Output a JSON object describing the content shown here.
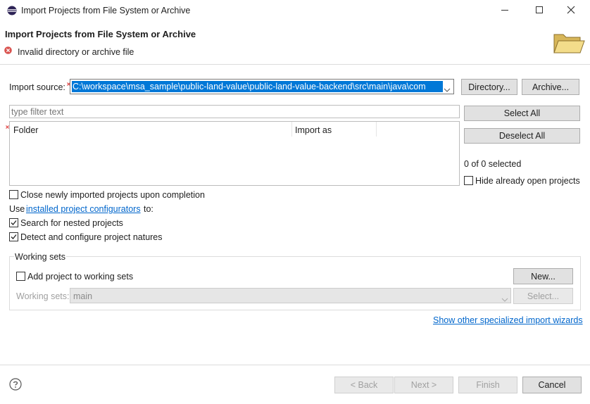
{
  "window": {
    "title": "Import Projects from File System or Archive"
  },
  "header": {
    "title": "Import Projects from File System or Archive",
    "error_message": "Invalid directory or archive file"
  },
  "import_source": {
    "label": "Import source:",
    "value": "C:\\workspace\\msa_sample\\public-land-value\\public-land-value-backend\\src\\main\\java\\com",
    "directory_button": "Directory...",
    "archive_button": "Archive..."
  },
  "filter": {
    "placeholder": "type filter text"
  },
  "table": {
    "columns": [
      "Folder",
      "Import as"
    ]
  },
  "side_buttons": {
    "select_all": "Select All",
    "deselect_all": "Deselect All"
  },
  "selection_count": "0 of 0 selected",
  "hide_open_projects": {
    "label": "Hide already open projects",
    "checked": false
  },
  "options": {
    "close_imported": {
      "label": "Close newly imported projects upon completion",
      "checked": false
    },
    "use_prefix": "Use",
    "configurators_link": "installed project configurators",
    "use_suffix": "to:",
    "search_nested": {
      "label": "Search for nested projects",
      "checked": true
    },
    "detect_natures": {
      "label": "Detect and configure project natures",
      "checked": true
    }
  },
  "working_sets": {
    "group_label": "Working sets",
    "add_label": "Add project to working sets",
    "add_checked": false,
    "new_button": "New...",
    "sets_label": "Working sets:",
    "sets_value": "main",
    "select_button": "Select..."
  },
  "specialized_link": "Show other specialized import wizards",
  "footer": {
    "back": "< Back",
    "next": "Next >",
    "finish": "Finish",
    "cancel": "Cancel"
  },
  "colors": {
    "accent": "#0078d7",
    "link": "#0066cc",
    "error": "#d9534f"
  }
}
